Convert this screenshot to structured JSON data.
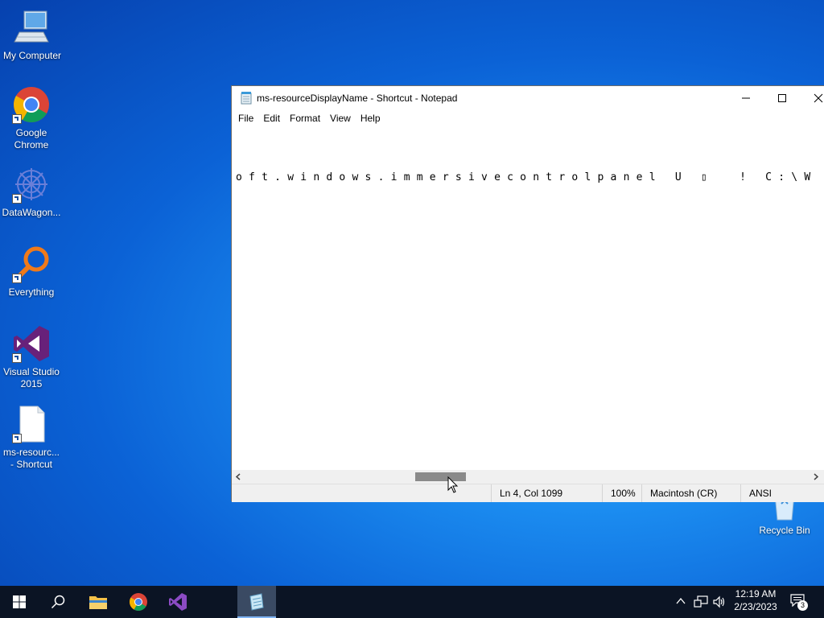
{
  "desktop": {
    "icons": [
      {
        "label": "My Computer",
        "icon": "computer-icon"
      },
      {
        "label": "Google Chrome",
        "icon": "chrome-icon"
      },
      {
        "label": "DataWagon...",
        "icon": "datawagon-icon"
      },
      {
        "label": "Everything",
        "icon": "everything-search-icon"
      },
      {
        "label": "Visual Studio 2015",
        "icon": "visual-studio-icon"
      },
      {
        "label": "ms-resourc... - Shortcut",
        "icon": "text-file-icon"
      },
      {
        "label": "Recycle Bin",
        "icon": "recycle-bin-icon"
      }
    ]
  },
  "notepad": {
    "title": "ms-resourceDisplayName - Shortcut - Notepad",
    "menu": [
      "File",
      "Edit",
      "Format",
      "View",
      "Help"
    ],
    "content_line": "o f t . w i n d o w s . i m m e r s i v e c o n t r o l p a n e l   U   ▯     !   C : \\ W",
    "status": {
      "position": "Ln 4, Col 1099",
      "zoom": "100%",
      "line_ending": "Macintosh (CR)",
      "encoding": "ANSI"
    },
    "scroll_position_fraction": 0.33
  },
  "taskbar": {
    "clock_time": "12:19 AM",
    "clock_date": "2/23/2023",
    "notification_count": "3"
  }
}
